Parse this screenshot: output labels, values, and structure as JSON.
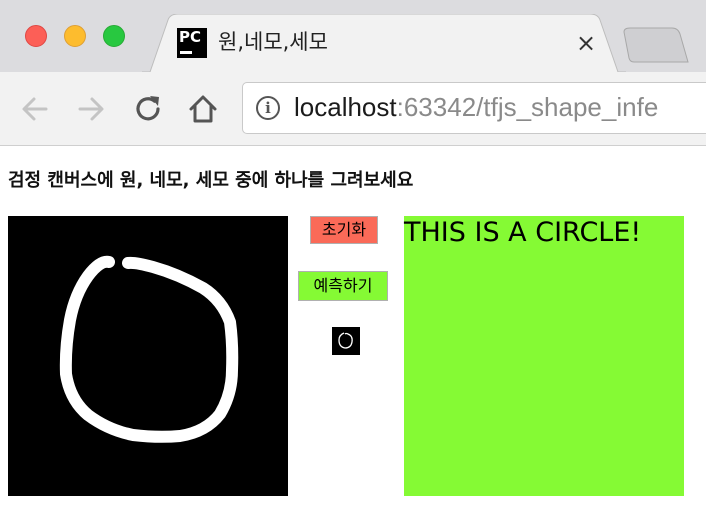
{
  "browser": {
    "tab": {
      "title": "원,네모,세모",
      "favicon_text": "PC"
    },
    "address_bar": {
      "host": "localhost",
      "path": ":63342/tfjs_shape_infe"
    }
  },
  "page": {
    "heading": "검정 캔버스에 원, 네모, 세모 중에 하나를 그려보세요",
    "reset_label": "초기화",
    "predict_label": "예측하기",
    "result_text": "THIS IS A CIRCLE!",
    "colors": {
      "reset_button": "#fa6a58",
      "predict_button": "#85fa34",
      "result_background": "#85fa34",
      "canvas_background": "#000000",
      "stroke": "#ffffff"
    }
  }
}
